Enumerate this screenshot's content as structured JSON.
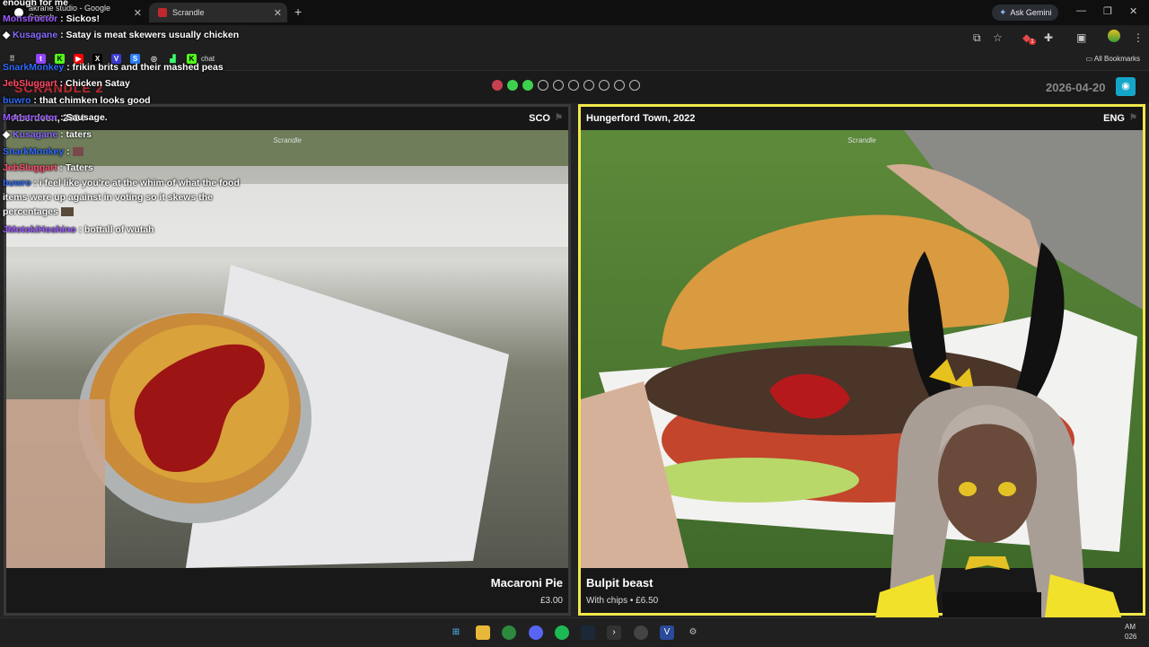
{
  "browser": {
    "tabs": [
      {
        "title": "akrane studio - Google Search",
        "close": "✕"
      },
      {
        "title": "Scrandle",
        "close": "✕"
      }
    ],
    "new_tab": "+",
    "ask_gemini": "Ask Gemini",
    "window_controls": {
      "minimize": "—",
      "maximize": "❐",
      "close": "✕"
    },
    "all_bookmarks": "All Bookmarks",
    "bookmark_chat_label": "chat",
    "extension_badge": "1"
  },
  "scrandle": {
    "logo": "SCRANDLE 2",
    "progress": [
      "red",
      "green",
      "green",
      "empty",
      "empty",
      "empty",
      "empty",
      "empty",
      "empty",
      "empty"
    ],
    "date": "2026-04-20",
    "eye_icon": "eye-icon",
    "watermark": "Scrandle",
    "left_card": {
      "place": "Aberdeen, 2024",
      "country": "SCO",
      "food": "Macaroni Pie",
      "desc": "£3.00"
    },
    "right_card": {
      "place": "Hungerford Town, 2022",
      "country": "ENG",
      "food": "Bulpit beast",
      "desc": "With chips • £6.50"
    }
  },
  "chat": {
    "messages": [
      {
        "user": "",
        "text": "enough for me",
        "color": "#ffffff"
      },
      {
        "user": "Monstructor",
        "text": "Sickos!",
        "color": "#9b59ff"
      },
      {
        "user": "Kusagane",
        "text": "Satay is meat skewers usually chicken",
        "color": "#8a6bff"
      },
      {
        "user": "SnarkMonkey",
        "text": "frikin brits and their mashed peas",
        "color": "#2f6bff"
      },
      {
        "user": "JebSluggart",
        "text": "Chicken Satay",
        "color": "#ff4d6a"
      },
      {
        "user": "buwro",
        "text": "that chimken looks good",
        "color": "#2f6bff"
      },
      {
        "user": "Monstructor",
        "text": "Sausage.",
        "color": "#9b59ff"
      },
      {
        "user": "Kusagane",
        "text": "taters",
        "color": "#8a6bff"
      },
      {
        "user": "SnarkMonkey",
        "text": "",
        "color": "#2f6bff"
      },
      {
        "user": "JebSluggart",
        "text": "Taters",
        "color": "#ff4d6a"
      },
      {
        "user": "buwro",
        "text": "i feel like you're at the whim of what the food items were up against in voting so it skews the percentages",
        "color": "#2f6bff"
      },
      {
        "user": "JMotokiHoshino",
        "text": "bottall of wutah",
        "color": "#9b59ff"
      }
    ]
  },
  "taskbar": {
    "clock_time": "AM",
    "clock_date": "026"
  },
  "colors": {
    "accent_yellow": "#f1e84b",
    "eye_button": "#14a6c9",
    "logo_red": "#c0282d"
  }
}
